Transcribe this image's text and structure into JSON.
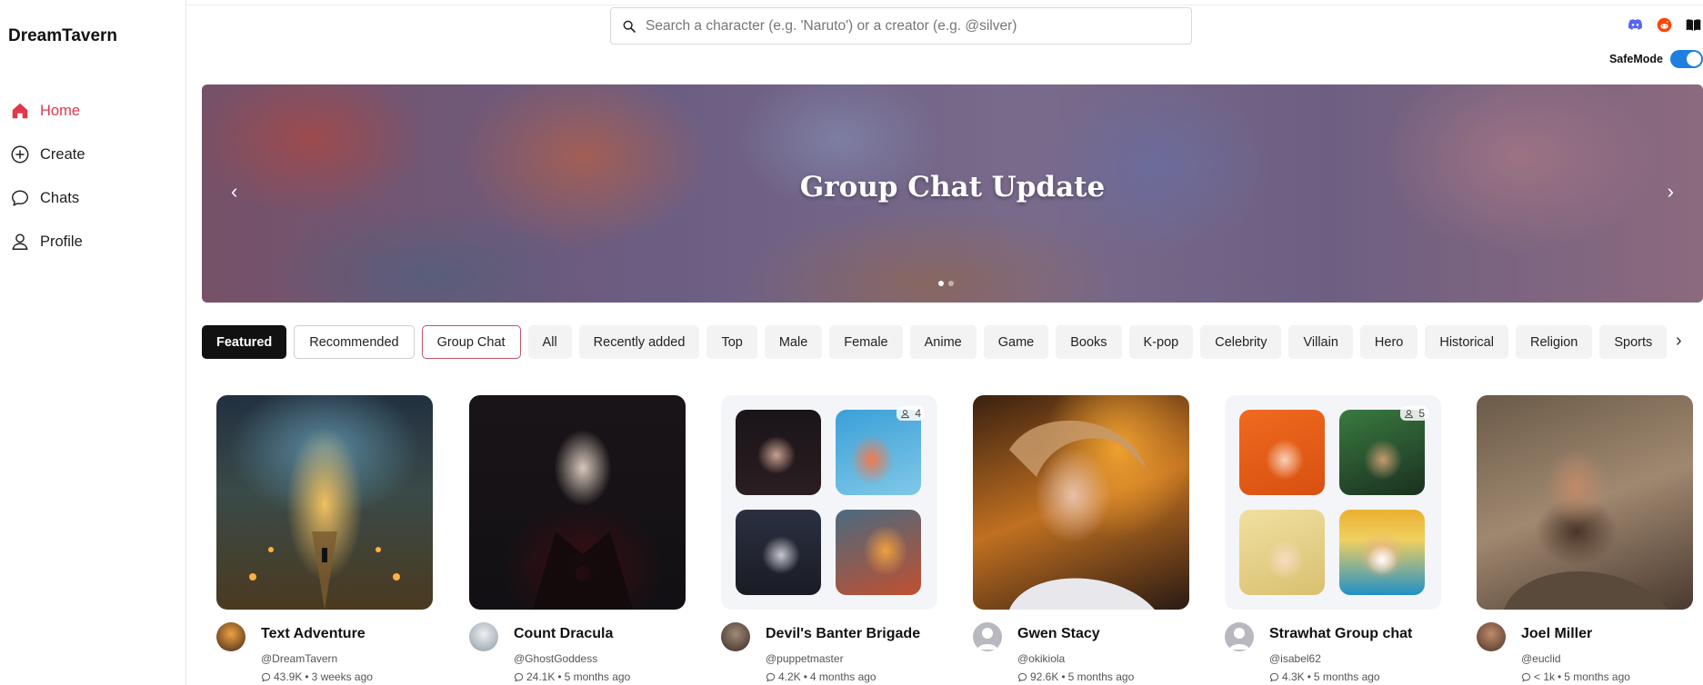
{
  "app": {
    "name": "DreamTavern"
  },
  "nav": [
    {
      "label": "Home",
      "icon": "home-icon",
      "active": true
    },
    {
      "label": "Create",
      "icon": "plus-circle-icon",
      "active": false
    },
    {
      "label": "Chats",
      "icon": "chat-bubble-icon",
      "active": false
    },
    {
      "label": "Profile",
      "icon": "user-icon",
      "active": false
    }
  ],
  "search": {
    "placeholder": "Search a character (e.g. 'Naruto') or a creator (e.g. @silver)"
  },
  "top_icons": [
    "discord-icon",
    "reddit-icon",
    "book-icon"
  ],
  "safemode": {
    "label": "SafeMode",
    "enabled": true
  },
  "banner": {
    "title": "Group Chat Update",
    "slide_count": 2,
    "active_slide": 1
  },
  "chips": [
    "Featured",
    "Recommended",
    "Group Chat",
    "All",
    "Recently added",
    "Top",
    "Male",
    "Female",
    "Anime",
    "Game",
    "Books",
    "K-pop",
    "Celebrity",
    "Villain",
    "Hero",
    "Historical",
    "Religion",
    "Sports"
  ],
  "cards": [
    {
      "name": "Text Adventure",
      "creator": "@DreamTavern",
      "chats": "43.9K",
      "time": "3 weeks ago"
    },
    {
      "name": "Count Dracula",
      "creator": "@GhostGoddess",
      "chats": "24.1K",
      "time": "5 months ago"
    },
    {
      "name": "Devil's Banter Brigade",
      "creator": "@puppetmaster",
      "chats": "4.2K",
      "time": "4 months ago",
      "members": "4"
    },
    {
      "name": "Gwen Stacy",
      "creator": "@okikiola",
      "chats": "92.6K",
      "time": "5 months ago"
    },
    {
      "name": "Strawhat Group chat",
      "creator": "@isabel62",
      "chats": "4.3K",
      "time": "5 months ago",
      "members": "5"
    },
    {
      "name": "Joel Miller",
      "creator": "@euclid",
      "chats": "< 1k",
      "time": "5 months ago"
    }
  ],
  "colors": {
    "accent": "#e0374d",
    "toggle": "#1e7fe0",
    "group_chip_border": "#c25268"
  }
}
